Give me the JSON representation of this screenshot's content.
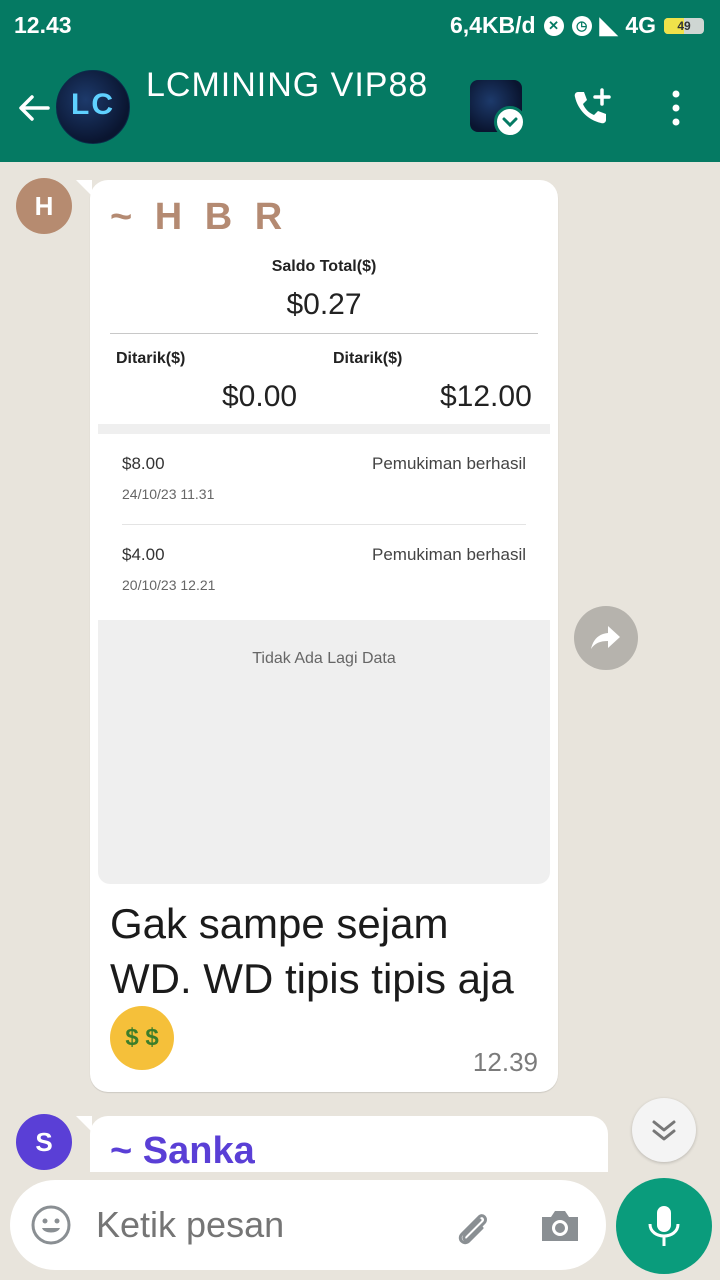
{
  "status_bar": {
    "time": "12.43",
    "data_rate": "6,4KB/d",
    "network": "4G",
    "battery": "49",
    "battery_level": 0.49
  },
  "header": {
    "title": "LCMINING VIP88",
    "avatar_text": "LC"
  },
  "messages": [
    {
      "avatar_initial": "H",
      "sender": "~ H B R",
      "screenshot": {
        "saldo_label": "Saldo Total($)",
        "saldo_value": "$0.27",
        "ditarik1_label": "Ditarik($)",
        "ditarik1_value": "$0.00",
        "ditarik2_label": "Ditarik($)",
        "ditarik2_value": "$12.00",
        "transactions": [
          {
            "amount": "$8.00",
            "date": "24/10/23 11.31",
            "status": "Pemukiman berhasil"
          },
          {
            "amount": "$4.00",
            "date": "20/10/23 12.21",
            "status": "Pemukiman berhasil"
          }
        ],
        "no_more_data": "Tidak Ada Lagi Data"
      },
      "text": "Gak sampe sejam WD. WD tipis tipis aja",
      "time": "12.39"
    },
    {
      "avatar_initial": "S",
      "sender": "~ Sanka"
    }
  ],
  "input": {
    "placeholder": "Ketik pesan"
  },
  "colors": {
    "header": "#057a63",
    "mic": "#0a9c7c",
    "sender_hbr": "#b48a72",
    "sender_sanka": "#5a3fd6"
  }
}
